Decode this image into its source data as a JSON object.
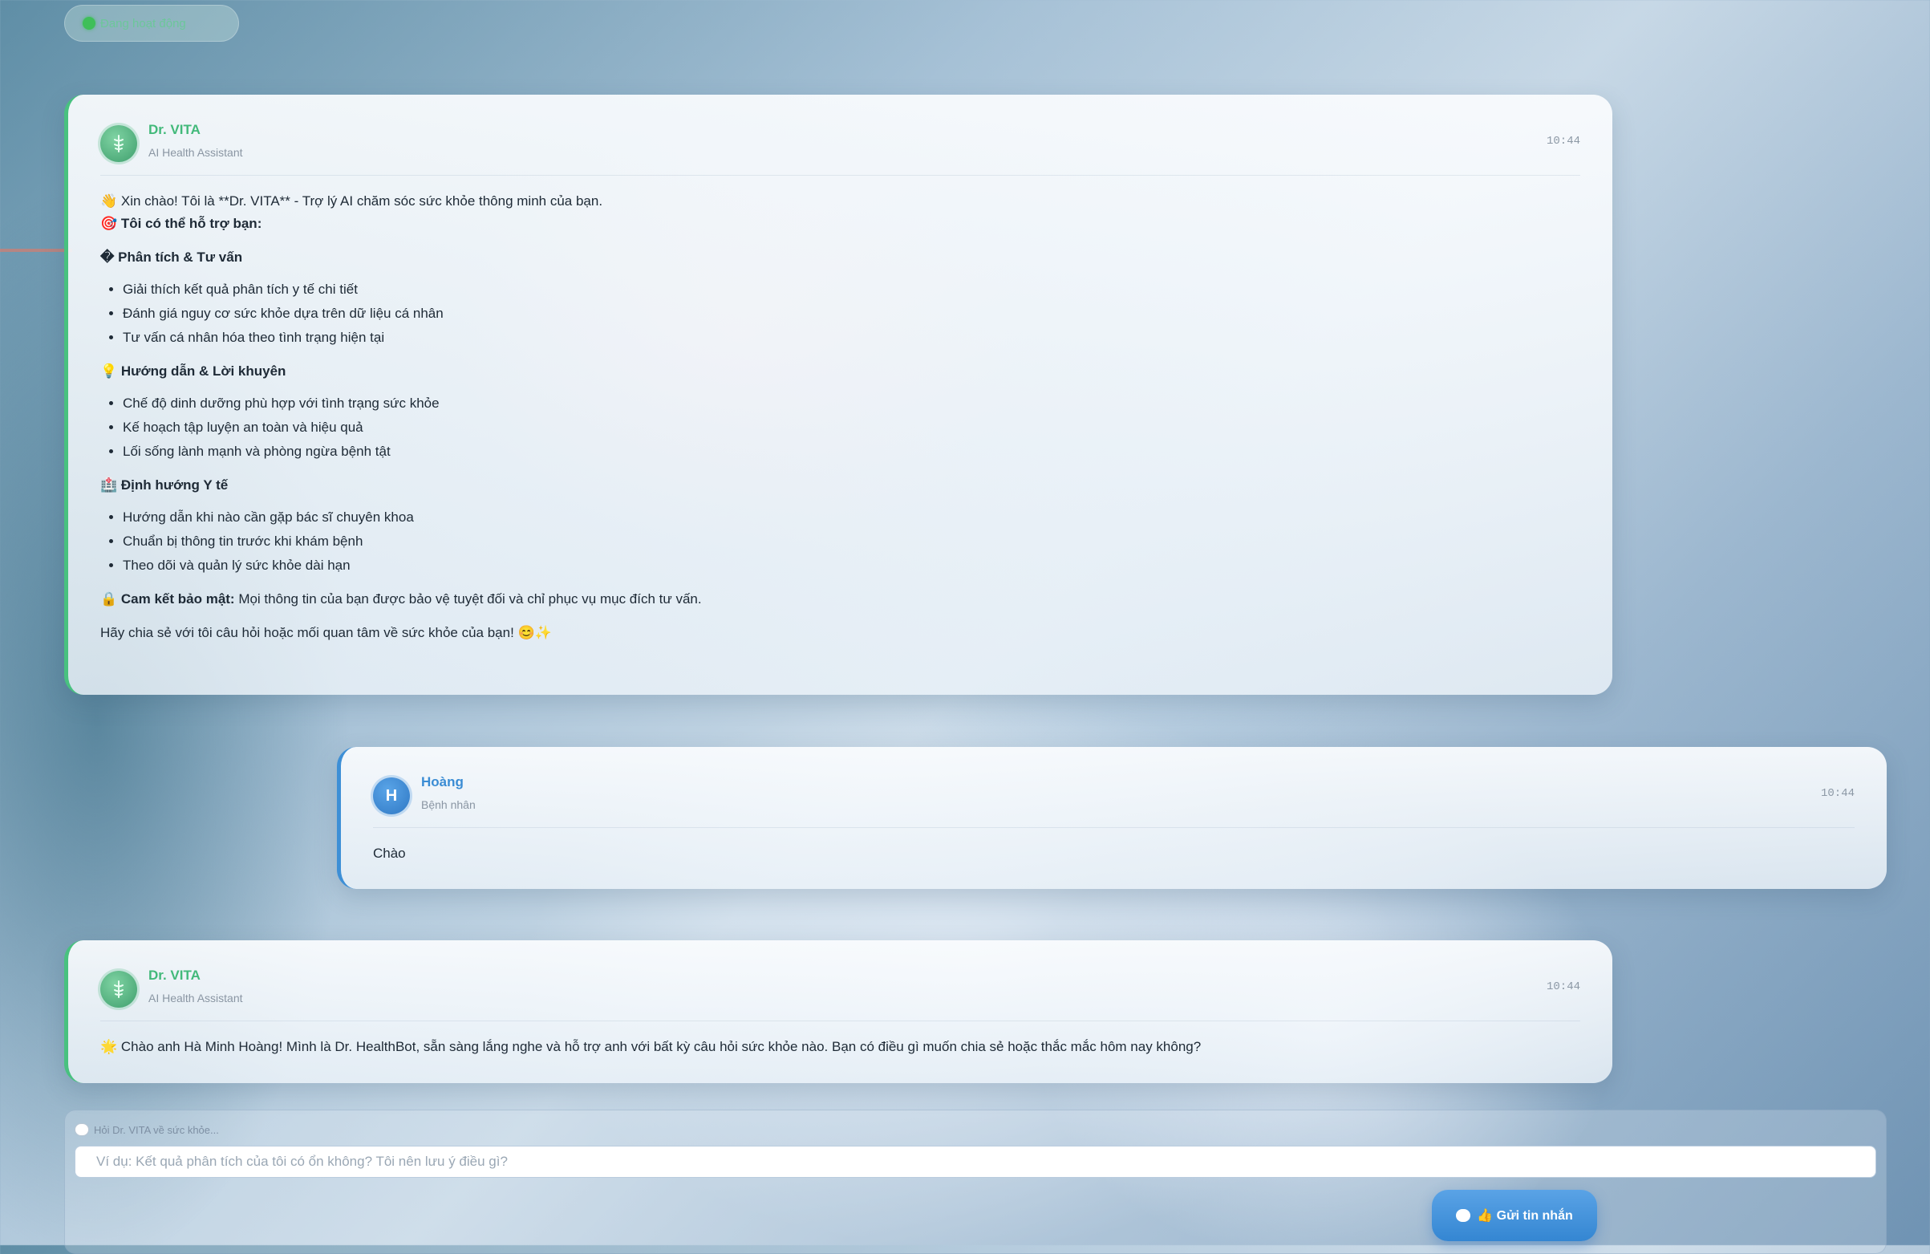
{
  "status": {
    "text": "Đang hoạt động"
  },
  "messages": [
    {
      "sender": "Dr. VITA",
      "role": "AI Health Assistant",
      "time": "10:44",
      "intro": "👋 Xin chào! Tôi là **Dr. VITA** - Trợ lý AI chăm sóc sức khỏe thông minh của bạn.",
      "capabilities_title": "🎯 Tôi có thể hỗ trợ bạn:",
      "sections": [
        {
          "title": "� Phân tích & Tư vấn",
          "items": [
            "Giải thích kết quả phân tích y tế chi tiết",
            "Đánh giá nguy cơ sức khỏe dựa trên dữ liệu cá nhân",
            "Tư vấn cá nhân hóa theo tình trạng hiện tại"
          ]
        },
        {
          "title": "💡 Hướng dẫn & Lời khuyên",
          "items": [
            "Chế độ dinh dưỡng phù hợp với tình trạng sức khỏe",
            "Kế hoạch tập luyện an toàn và hiệu quả",
            "Lối sống lành mạnh và phòng ngừa bệnh tật"
          ]
        },
        {
          "title": "🏥 Định hướng Y tế",
          "items": [
            "Hướng dẫn khi nào cần gặp bác sĩ chuyên khoa",
            "Chuẩn bị thông tin trước khi khám bệnh",
            "Theo dõi và quản lý sức khỏe dài hạn"
          ]
        }
      ],
      "security_label": "🔒 Cam kết bảo mật:",
      "security_text": " Mọi thông tin của bạn được bảo vệ tuyệt đối và chỉ phục vụ mục đích tư vấn.",
      "closing": "Hãy chia sẻ với tôi câu hỏi hoặc mối quan tâm về sức khỏe của bạn! 😊✨"
    },
    {
      "sender": "Hoàng",
      "initial": "H",
      "role": "Bệnh nhân",
      "time": "10:44",
      "text": "Chào"
    },
    {
      "sender": "Dr. VITA",
      "role": "AI Health Assistant",
      "time": "10:44",
      "text": "🌟 Chào anh Hà Minh Hoàng! Mình là Dr. HealthBot, sẵn sàng lắng nghe và hỗ trợ anh với bất kỳ câu hỏi sức khỏe nào. Bạn có điều gì muốn chia sẻ hoặc thắc mắc hôm nay không?"
    }
  ],
  "composer": {
    "label": "Hỏi Dr. VITA về sức khỏe...",
    "placeholder": "Ví dụ: Kết quả phân tích của tôi có ổn không? Tôi nên lưu ý điều gì?",
    "send_label": "👍 Gửi tin nhắn"
  }
}
